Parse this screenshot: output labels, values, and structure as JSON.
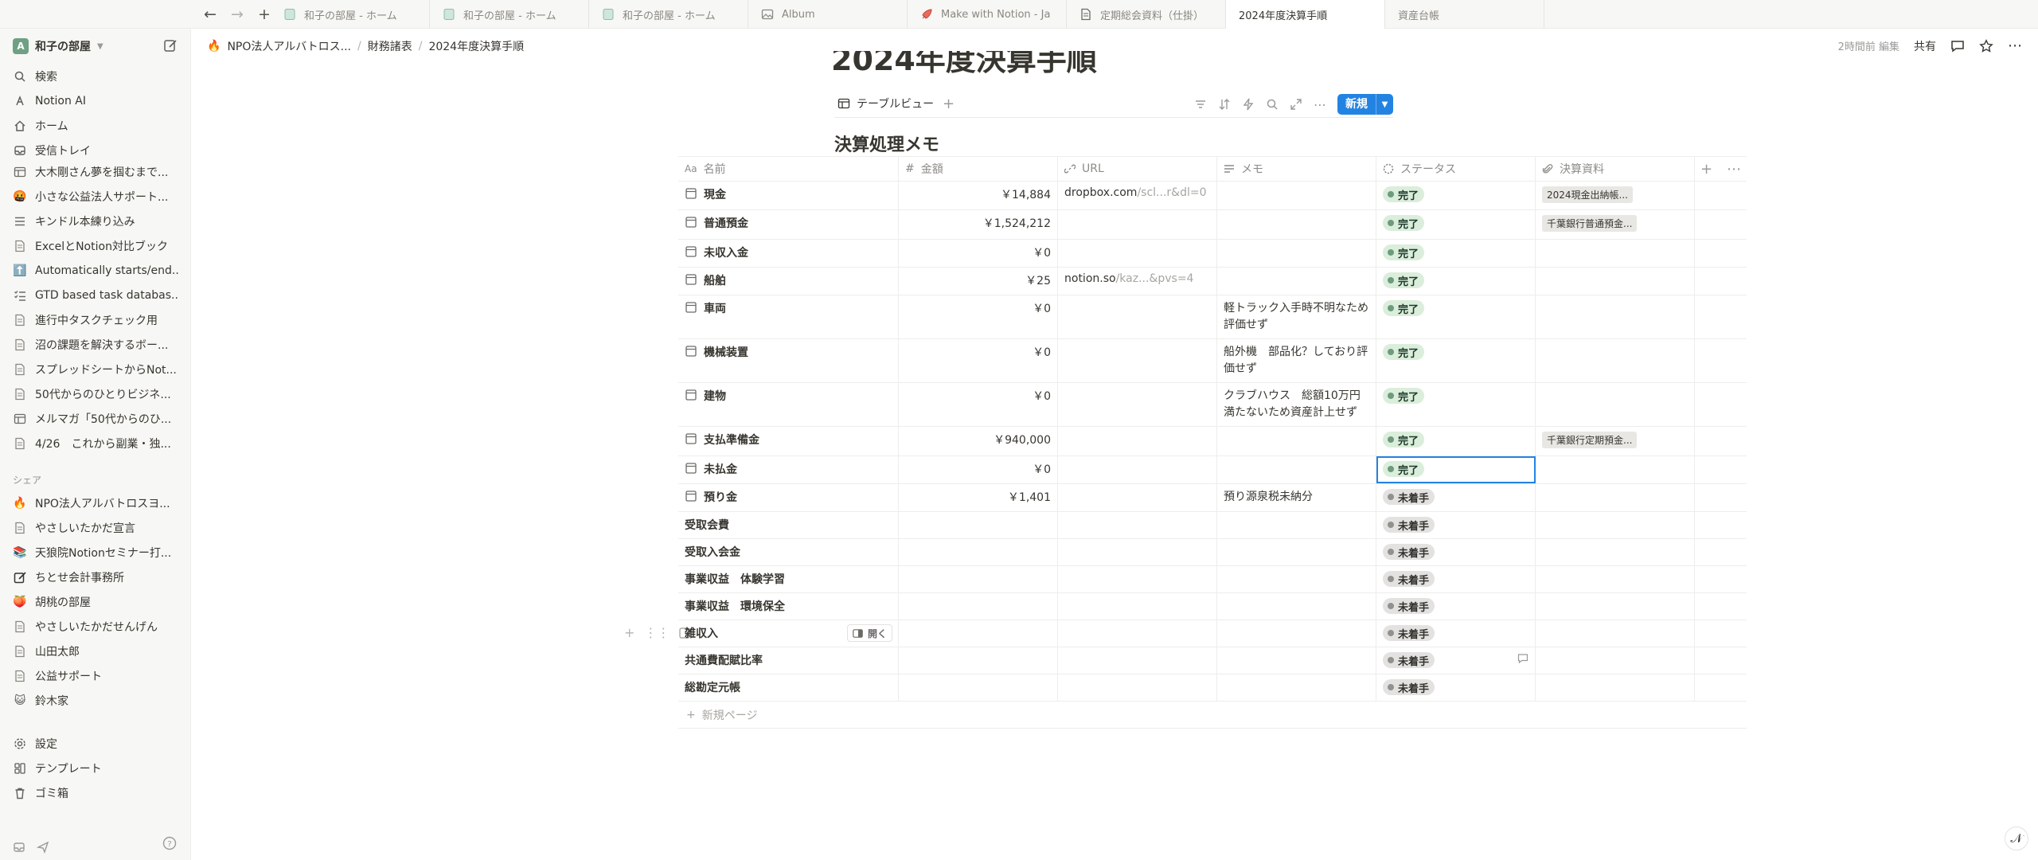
{
  "tabs": [
    {
      "label": "和子の部屋 - ホーム",
      "icon": "page-emoji-icon",
      "active": false
    },
    {
      "label": "和子の部屋 - ホーム",
      "icon": "page-emoji-icon",
      "active": false
    },
    {
      "label": "和子の部屋 - ホーム",
      "icon": "page-emoji-icon",
      "active": false
    },
    {
      "label": "Album",
      "icon": "image-icon",
      "active": false
    },
    {
      "label": "Make with Notion - Ja",
      "icon": "rocket-icon",
      "active": false
    },
    {
      "label": "定期総会資料（仕掛）",
      "icon": "document-icon",
      "active": false
    },
    {
      "label": "2024年度決算手順",
      "icon": "",
      "active": true
    },
    {
      "label": "資産台帳",
      "icon": "",
      "active": false
    }
  ],
  "sidebar": {
    "workspace_initial": "A",
    "workspace_name": "和子の部屋",
    "top_items": [
      {
        "label": "検索",
        "icon": "search-icon"
      },
      {
        "label": "Notion AI",
        "icon": "ai-icon"
      },
      {
        "label": "ホーム",
        "icon": "home-icon"
      },
      {
        "label": "受信トレイ",
        "icon": "inbox-icon"
      }
    ],
    "pages": [
      {
        "label": "大木剛さん夢を掴むまで...",
        "icon": "table-icon"
      },
      {
        "label": "小さな公益法人サポート...",
        "icon": "red-emoji-icon"
      },
      {
        "label": "キンドル本練り込み",
        "icon": "list-icon"
      },
      {
        "label": "ExcelとNotion対比ブック",
        "icon": "page-icon"
      },
      {
        "label": "Automatically starts/end...",
        "icon": "up-arrow-emoji-icon"
      },
      {
        "label": "GTD based task databas...",
        "icon": "checklist-icon"
      },
      {
        "label": "進行中タスクチェック用",
        "icon": "page-icon"
      },
      {
        "label": "沼の課題を解決するボー...",
        "icon": "page-icon"
      },
      {
        "label": "スプレッドシートからNot...",
        "icon": "page-icon"
      },
      {
        "label": "50代からのひとりビジネ...",
        "icon": "page-icon"
      },
      {
        "label": "メルマガ「50代からのひ...",
        "icon": "table-icon"
      },
      {
        "label": "4/26　これから副業・独...",
        "icon": "page-icon"
      }
    ],
    "shared_label": "シェア",
    "shared": [
      {
        "label": "NPO法人アルバトロスヨ...",
        "icon": "fire-emoji-icon"
      },
      {
        "label": "やさしいたかだ宣言",
        "icon": "page-icon"
      },
      {
        "label": "天狼院Notionセミナー打...",
        "icon": "books-emoji-icon"
      },
      {
        "label": "ちとせ会計事務所",
        "icon": "edit-icon"
      },
      {
        "label": "胡桃の部屋",
        "icon": "peach-emoji-icon"
      },
      {
        "label": "やさしいたかだせんげん",
        "icon": "page-icon"
      },
      {
        "label": "山田太郎",
        "icon": "page-icon"
      },
      {
        "label": "公益サポート",
        "icon": "page-icon"
      },
      {
        "label": "鈴木家",
        "icon": "cat-emoji-icon"
      }
    ],
    "bottom_items": [
      {
        "label": "設定",
        "icon": "gear-icon"
      },
      {
        "label": "テンプレート",
        "icon": "template-icon"
      },
      {
        "label": "ゴミ箱",
        "icon": "trash-icon"
      }
    ]
  },
  "topbar": {
    "breadcrumb": [
      "NPO法人アルバトロス...",
      "財務諸表",
      "2024年度決算手順"
    ],
    "edited": "2時間前 編集",
    "share": "共有"
  },
  "page": {
    "title": "2024年度決算手順"
  },
  "view": {
    "tab_label": "テーブルビュー",
    "new_button": "新規",
    "db_title": "決算処理メモ"
  },
  "table": {
    "columns": {
      "name": "名前",
      "amount": "金額",
      "url": "URL",
      "memo": "メモ",
      "status": "ステータス",
      "files": "決算資料"
    },
    "open_label": "開く",
    "new_row_label": "新規ページ",
    "rows": [
      {
        "name": "現金",
        "has_icon": true,
        "amount": "￥14,884",
        "url_main": "dropbox.com",
        "url_dim": "/scl...r&dl=0",
        "memo": "",
        "status": "完了",
        "status_type": "done",
        "file": "2024現金出納帳..."
      },
      {
        "name": "普通預金",
        "has_icon": true,
        "amount": "￥1,524,212",
        "url_main": "",
        "url_dim": "",
        "memo": "",
        "status": "完了",
        "status_type": "done",
        "file": "千葉銀行普通預金..."
      },
      {
        "name": "未収入金",
        "has_icon": true,
        "amount": "￥0",
        "url_main": "",
        "url_dim": "",
        "memo": "",
        "status": "完了",
        "status_type": "done",
        "file": ""
      },
      {
        "name": "船舶",
        "has_icon": true,
        "amount": "￥25",
        "url_main": "notion.so",
        "url_dim": "/kaz...&pvs=4",
        "memo": "",
        "status": "完了",
        "status_type": "done",
        "file": ""
      },
      {
        "name": "車両",
        "has_icon": true,
        "amount": "￥0",
        "url_main": "",
        "url_dim": "",
        "memo": "軽トラック入手時不明なため評価せず",
        "status": "完了",
        "status_type": "done",
        "file": ""
      },
      {
        "name": "機械装置",
        "has_icon": true,
        "amount": "￥0",
        "url_main": "",
        "url_dim": "",
        "memo": "船外機　部品化？しており評価せず",
        "status": "完了",
        "status_type": "done",
        "file": ""
      },
      {
        "name": "建物",
        "has_icon": true,
        "amount": "￥0",
        "url_main": "",
        "url_dim": "",
        "memo": "クラブハウス　総額10万円満たないため資産計上せず",
        "status": "完了",
        "status_type": "done",
        "file": ""
      },
      {
        "name": "支払準備金",
        "has_icon": true,
        "amount": "￥940,000",
        "url_main": "",
        "url_dim": "",
        "memo": "",
        "status": "完了",
        "status_type": "done",
        "file": "千葉銀行定期預金..."
      },
      {
        "name": "未払金",
        "has_icon": true,
        "amount": "￥0",
        "url_main": "",
        "url_dim": "",
        "memo": "",
        "status": "完了",
        "status_type": "done",
        "file": "",
        "selected": true
      },
      {
        "name": "預り金",
        "has_icon": true,
        "amount": "￥1,401",
        "url_main": "",
        "url_dim": "",
        "memo": "預り源泉税未納分",
        "status": "未着手",
        "status_type": "todo",
        "file": ""
      },
      {
        "name": "受取会費",
        "has_icon": false,
        "amount": "",
        "url_main": "",
        "url_dim": "",
        "memo": "",
        "status": "未着手",
        "status_type": "todo",
        "file": ""
      },
      {
        "name": "受取入会金",
        "has_icon": false,
        "amount": "",
        "url_main": "",
        "url_dim": "",
        "memo": "",
        "status": "未着手",
        "status_type": "todo",
        "file": ""
      },
      {
        "name": "事業収益　体験学習",
        "has_icon": false,
        "amount": "",
        "url_main": "",
        "url_dim": "",
        "memo": "",
        "status": "未着手",
        "status_type": "todo",
        "file": ""
      },
      {
        "name": "事業収益　環境保全",
        "has_icon": false,
        "amount": "",
        "url_main": "",
        "url_dim": "",
        "memo": "",
        "status": "未着手",
        "status_type": "todo",
        "file": ""
      },
      {
        "name": "雑収入",
        "has_icon": false,
        "amount": "",
        "url_main": "",
        "url_dim": "",
        "memo": "",
        "status": "未着手",
        "status_type": "todo",
        "file": "",
        "hovered": true
      },
      {
        "name": "共通費配賦比率",
        "has_icon": false,
        "amount": "",
        "url_main": "",
        "url_dim": "",
        "memo": "",
        "status": "未着手",
        "status_type": "todo",
        "file": "",
        "comment": true
      },
      {
        "name": "総勘定元帳",
        "has_icon": false,
        "amount": "",
        "url_main": "",
        "url_dim": "",
        "memo": "",
        "status": "未着手",
        "status_type": "todo",
        "file": ""
      }
    ]
  }
}
